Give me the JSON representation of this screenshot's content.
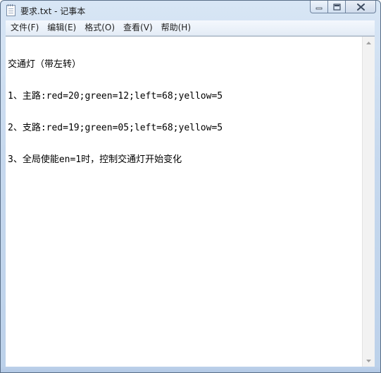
{
  "window": {
    "title": "要求.txt - 记事本",
    "icon": "notepad-icon"
  },
  "caption_buttons": {
    "minimize_icon": "minimize-icon",
    "maximize_icon": "maximize-icon",
    "close_icon": "close-icon"
  },
  "menubar": {
    "items": [
      {
        "label": "文件(F)"
      },
      {
        "label": "编辑(E)"
      },
      {
        "label": "格式(O)"
      },
      {
        "label": "查看(V)"
      },
      {
        "label": "帮助(H)"
      }
    ]
  },
  "editor": {
    "lines": [
      "交通灯（带左转）",
      "1、主路:red=20;green=12;left=68;yellow=5",
      "2、支路:red=19;green=05;left=68;yellow=5",
      "3、全局使能en=1时，控制交通灯开始变化"
    ]
  },
  "colors": {
    "frame": "#c7d9ee",
    "editor_background": "#ffffff",
    "text": "#000000"
  }
}
